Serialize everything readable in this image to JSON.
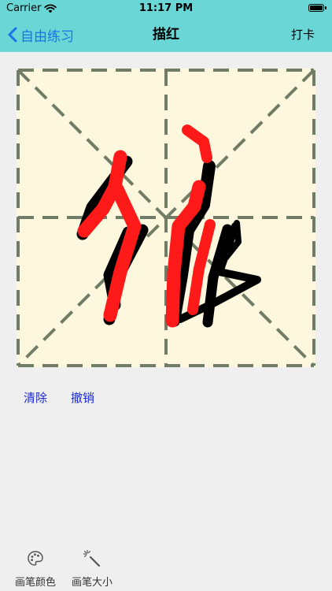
{
  "status_bar": {
    "carrier": "Carrier",
    "time": "11:17 PM"
  },
  "nav": {
    "back_label": "自由练习",
    "title": "描红",
    "right_label": "打卡"
  },
  "actions": {
    "clear_label": "清除",
    "undo_label": "撤销"
  },
  "toolbar": {
    "pen_color_label": "画笔颜色",
    "pen_size_label": "画笔大小"
  },
  "colors": {
    "header_bg": "#6ad6d6",
    "accent_blue": "#1a73e8",
    "action_blue": "#1c2ad6",
    "grid_bg": "#fdf7de",
    "grid_line": "#717c66",
    "stroke_red": "#ff1a1a",
    "stroke_black": "#000000"
  },
  "icons": {
    "back": "chevron-left-icon",
    "wifi": "wifi-icon",
    "battery": "battery-icon",
    "palette": "palette-icon",
    "magic_wand": "magic-wand-icon"
  }
}
